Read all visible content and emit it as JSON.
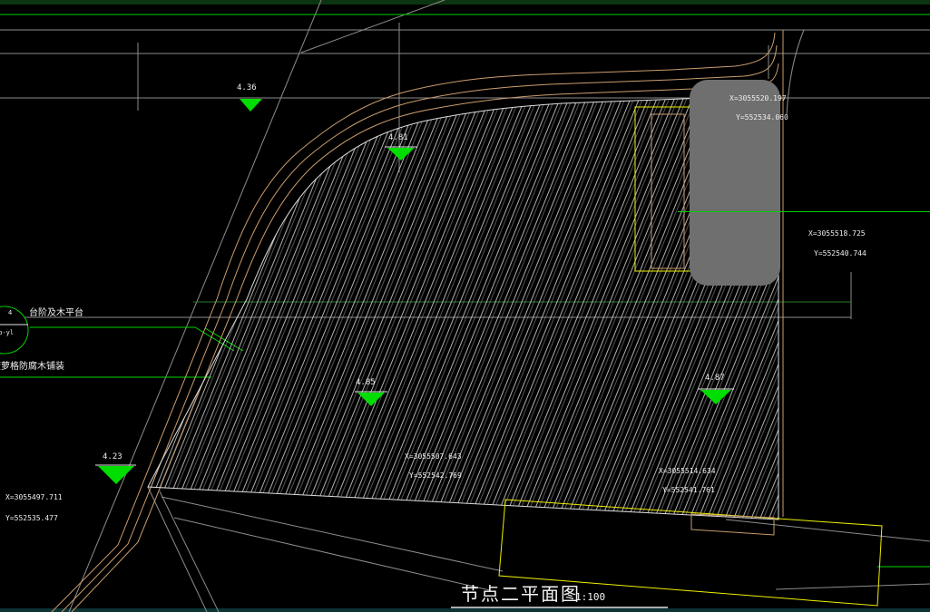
{
  "drawing": {
    "title": "节点二平面图",
    "scale": "1:100",
    "colors": {
      "green": "#00d400",
      "darkgreen": "#2a7a2a",
      "gray": "#8d8d8d",
      "tan": "#cb9d6d",
      "yellow": "#f0f000",
      "white": "#e6e6e6",
      "grayrect": "#6f6f6f",
      "tri": "#00dd00",
      "hatch": "#cfcfcf"
    },
    "elevations": [
      "4.36",
      "4.81",
      "4.85",
      "4.87",
      "4.23"
    ],
    "coords": [
      {
        "x": "X=3055520.197",
        "y": "Y=552534.060"
      },
      {
        "x": "X=3055518.725",
        "y": "Y=552540.744"
      },
      {
        "x": "X=3055507.643",
        "y": "Y=552542.769"
      },
      {
        "x": "X=3055514.634",
        "y": "Y=552541.761"
      },
      {
        "x": "X=3055497.711",
        "y": "Y=552535.477"
      }
    ],
    "annotations": [
      "台阶及木平台",
      "菠萝格防腐木铺装"
    ],
    "callout": {
      "number": "4",
      "ref": "Tb-yl"
    }
  }
}
